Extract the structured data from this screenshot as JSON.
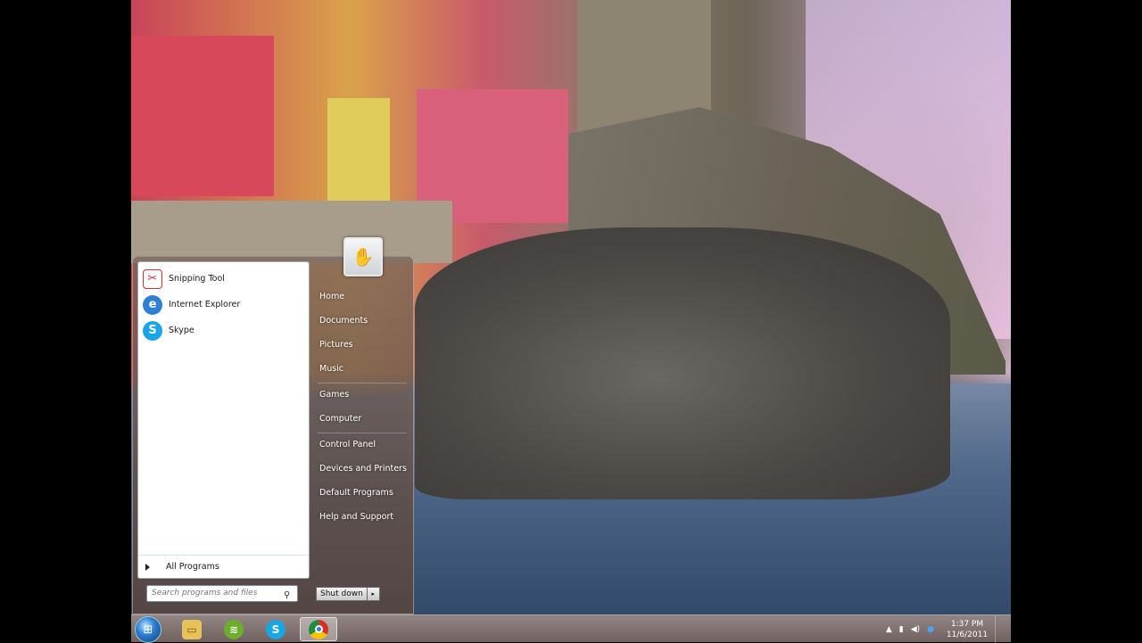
{
  "start_menu": {
    "programs": [
      {
        "label": "Snipping Tool",
        "icon": "scissors-icon"
      },
      {
        "label": "Internet Explorer",
        "icon": "internet-explorer-icon"
      },
      {
        "label": "Skype",
        "icon": "skype-icon"
      }
    ],
    "all_programs": "All Programs",
    "search_placeholder": "Search programs and files",
    "right_links": [
      "Home",
      "Documents",
      "Pictures",
      "Music",
      "Games",
      "Computer",
      "Control Panel",
      "Devices and Printers",
      "Default Programs",
      "Help and Support"
    ],
    "shutdown_label": "Shut down"
  },
  "taskbar": {
    "apps": [
      {
        "name": "windows-explorer",
        "icon": "folder-icon"
      },
      {
        "name": "spotify",
        "icon": "spotify-icon"
      },
      {
        "name": "skype",
        "icon": "skype-icon"
      },
      {
        "name": "chrome",
        "icon": "chrome-icon"
      }
    ],
    "time": "1:37 PM",
    "date": "11/6/2011"
  }
}
